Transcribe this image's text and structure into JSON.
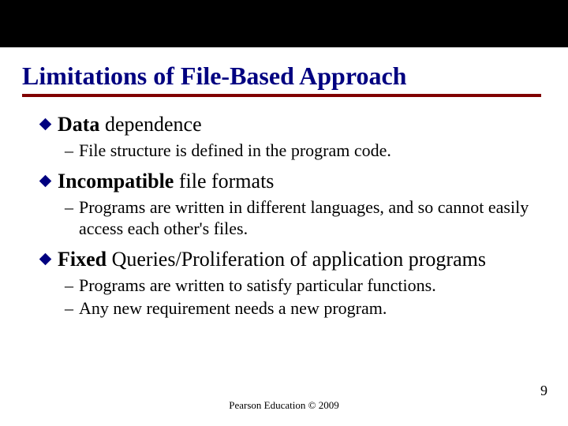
{
  "title": "Limitations of File-Based Approach",
  "items": [
    {
      "bold": "Data",
      "rest": " dependence",
      "subs": [
        "File structure is defined in the program code."
      ]
    },
    {
      "bold": "Incompatible",
      "rest": " file formats",
      "subs": [
        "Programs are written in different languages, and so cannot easily access each other's files."
      ]
    },
    {
      "bold": "Fixed",
      "rest": " Queries/Proliferation of application programs",
      "subs": [
        "Programs are written to satisfy particular functions.",
        "Any new requirement needs a new program."
      ]
    }
  ],
  "footer": "Pearson Education © 2009",
  "page": "9"
}
